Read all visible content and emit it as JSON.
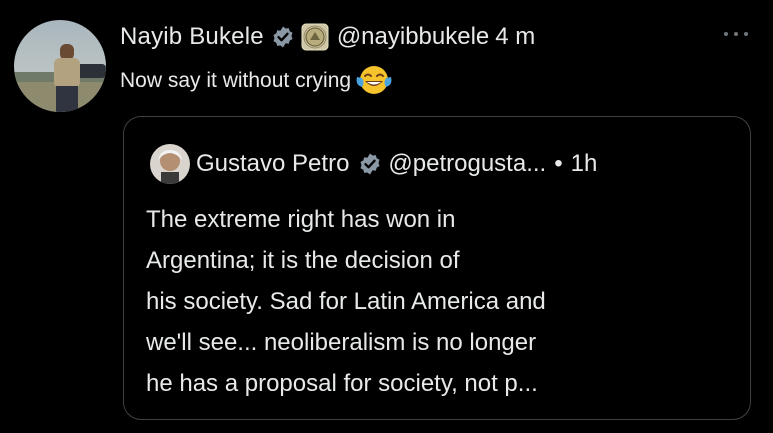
{
  "tweet": {
    "author_name": "Nayib Bukele",
    "handle": "@nayibbukele",
    "time": "4 m",
    "text": "Now say it without crying",
    "emoji": "😂",
    "more_label": "···"
  },
  "quote": {
    "author_name": "Gustavo Petro",
    "handle": "@petrogusta...",
    "separator": "•",
    "time": "1h",
    "lines": [
      "The extreme right has won in",
      "Argentina; it is the decision of",
      "his society. Sad for Latin America and",
      "we'll see... neoliberalism is no longer",
      "he has a proposal for society, not p..."
    ]
  },
  "colors": {
    "background": "#000000",
    "text": "#e7e9ea",
    "border": "#3e4144",
    "verified_badge": "#8b98a5"
  },
  "icons": {
    "verified": "verified-badge-icon",
    "government": "government-seal-icon",
    "more": "more-options-icon"
  }
}
